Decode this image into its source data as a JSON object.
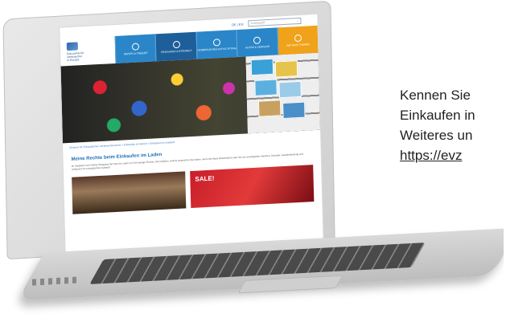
{
  "site": {
    "lang_switch": "DE | EN",
    "search_placeholder": "Suchbegriff",
    "logo_text": [
      "Das portal für",
      "Verbraucher",
      "in Europa"
    ],
    "nav": [
      {
        "label": "Reisen & Freizeit",
        "style": "normal"
      },
      {
        "label": "Einkaufen & Internet",
        "style": "dark"
      },
      {
        "label": "Verbraucher-Schlichtung",
        "style": "normal"
      },
      {
        "label": "Autos & Verkehr",
        "style": "normal"
      },
      {
        "label": "Weitere Themen",
        "style": "orange"
      }
    ],
    "breadcrumb": "Zentrum für Europäischen Verbraucherschutz » Einkaufen & Internet » Einkaufen im Ausland",
    "title": "Meine Rechte beim Einkaufen im Laden",
    "body": "Im Vergleich zum Online-Shopping hat man im Laden vor Ort weniger Rechte. Wir erklären, welche Ansprüche Sie haben, wenn die Ware fehlerhaft ist oder Sie sie zurückgeben möchten. Garantie, Gewährleistung und Umtausch im europäischen Ausland.",
    "sale_sign": "SALE!"
  },
  "side_text": {
    "line1": "Kennen Sie",
    "line2": "Einkaufen in",
    "line3": "Weiteres un",
    "link": "https://evz"
  }
}
